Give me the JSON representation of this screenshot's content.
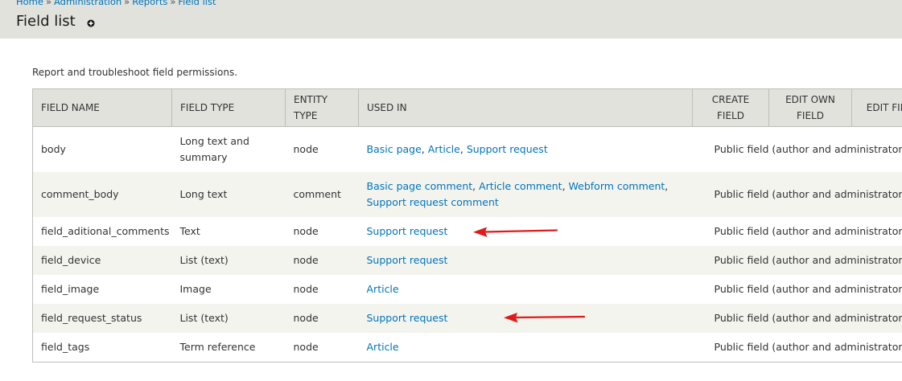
{
  "breadcrumb": [
    {
      "label": "Home"
    },
    {
      "label": "Administration"
    },
    {
      "label": "Reports"
    },
    {
      "label": "Field list"
    }
  ],
  "breadcrumb_separator": "»",
  "page_title": "Field list",
  "description": "Report and troubleshoot field permissions.",
  "table": {
    "headers": [
      "FIELD NAME",
      "FIELD TYPE",
      "ENTITY TYPE",
      "USED IN",
      "CREATE FIELD",
      "EDIT OWN FIELD",
      "EDIT FIELD"
    ],
    "rows": [
      {
        "field_name": "body",
        "field_type": "Long text and summary",
        "entity_type": "node",
        "used_in": [
          "Basic page",
          "Article",
          "Support request"
        ],
        "permission": "Public field (author and administrators can edit, everyone can view)"
      },
      {
        "field_name": "comment_body",
        "field_type": "Long text",
        "entity_type": "comment",
        "used_in": [
          "Basic page comment",
          "Article comment",
          "Webform comment",
          "Support request comment"
        ],
        "permission": "Public field (author and administrators can edit, everyone can view)"
      },
      {
        "field_name": "field_aditional_comments",
        "field_type": "Text",
        "entity_type": "node",
        "used_in": [
          "Support request"
        ],
        "permission": "Public field (author and administrators can edit, everyone can view)"
      },
      {
        "field_name": "field_device",
        "field_type": "List (text)",
        "entity_type": "node",
        "used_in": [
          "Support request"
        ],
        "permission": "Public field (author and administrators can edit, everyone can view)"
      },
      {
        "field_name": "field_image",
        "field_type": "Image",
        "entity_type": "node",
        "used_in": [
          "Article"
        ],
        "permission": "Public field (author and administrators can edit, everyone can view)"
      },
      {
        "field_name": "field_request_status",
        "field_type": "List (text)",
        "entity_type": "node",
        "used_in": [
          "Support request"
        ],
        "permission": "Public field (author and administrators can edit, everyone can view)"
      },
      {
        "field_name": "field_tags",
        "field_type": "Term reference",
        "entity_type": "node",
        "used_in": [
          "Article"
        ],
        "permission": "Public field (author and administrators can edit, everyone can view)"
      }
    ]
  },
  "colors": {
    "link": "#0074bd",
    "header_bg": "#e1e2dc",
    "row_alt_bg": "#f3f4ee",
    "arrow": "#e01b1b"
  },
  "icons": {
    "shortcut": "add-shortcut-icon",
    "annotation": "red-arrow-icon"
  }
}
